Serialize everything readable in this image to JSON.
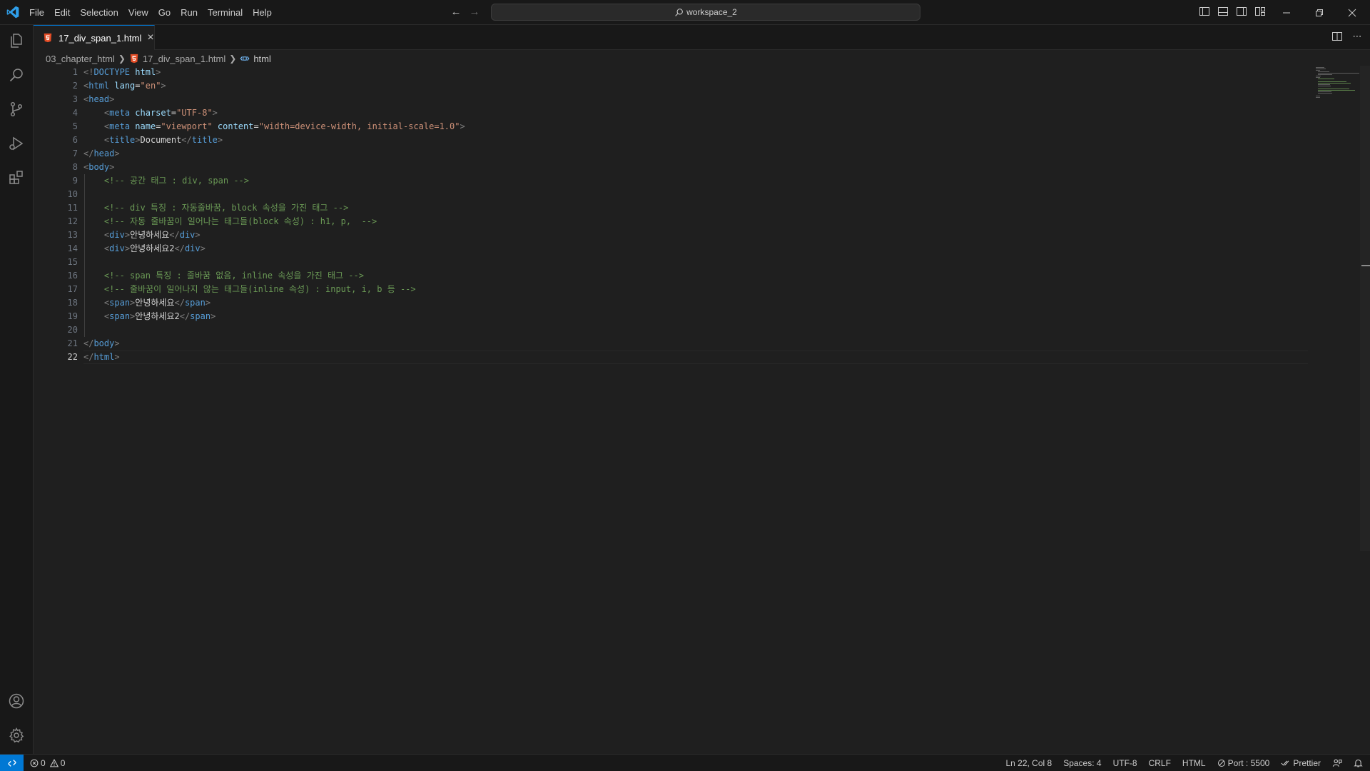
{
  "menu": [
    "File",
    "Edit",
    "Selection",
    "View",
    "Go",
    "Run",
    "Terminal",
    "Help"
  ],
  "command_center": {
    "label": "workspace_2",
    "icon": "search-icon"
  },
  "tab": {
    "label": "17_div_span_1.html",
    "icon": "html5-icon",
    "close": "×"
  },
  "breadcrumb": {
    "folder": "03_chapter_html",
    "file": "17_div_span_1.html",
    "symbol": "html"
  },
  "editor": {
    "active_line": 22,
    "line_numbers": [
      "1",
      "2",
      "3",
      "4",
      "5",
      "6",
      "7",
      "8",
      "9",
      "10",
      "11",
      "12",
      "13",
      "14",
      "15",
      "16",
      "17",
      "18",
      "19",
      "20",
      "21",
      "22"
    ],
    "lines": [
      [
        [
          "pun",
          "<!"
        ],
        [
          "tag",
          "DOCTYPE"
        ],
        [
          "txt",
          " "
        ],
        [
          "attr",
          "html"
        ],
        [
          "pun",
          ">"
        ]
      ],
      [
        [
          "pun",
          "<"
        ],
        [
          "tag",
          "html"
        ],
        [
          "txt",
          " "
        ],
        [
          "attr",
          "lang"
        ],
        [
          "txt",
          "="
        ],
        [
          "str",
          "\"en\""
        ],
        [
          "pun",
          ">"
        ]
      ],
      [
        [
          "pun",
          "<"
        ],
        [
          "tag",
          "head"
        ],
        [
          "pun",
          ">"
        ]
      ],
      [
        [
          "txt",
          "    "
        ],
        [
          "pun",
          "<"
        ],
        [
          "tag",
          "meta"
        ],
        [
          "txt",
          " "
        ],
        [
          "attr",
          "charset"
        ],
        [
          "txt",
          "="
        ],
        [
          "str",
          "\"UTF-8\""
        ],
        [
          "pun",
          ">"
        ]
      ],
      [
        [
          "txt",
          "    "
        ],
        [
          "pun",
          "<"
        ],
        [
          "tag",
          "meta"
        ],
        [
          "txt",
          " "
        ],
        [
          "attr",
          "name"
        ],
        [
          "txt",
          "="
        ],
        [
          "str",
          "\"viewport\""
        ],
        [
          "txt",
          " "
        ],
        [
          "attr",
          "content"
        ],
        [
          "txt",
          "="
        ],
        [
          "str",
          "\"width=device-width, initial-scale=1.0\""
        ],
        [
          "pun",
          ">"
        ]
      ],
      [
        [
          "txt",
          "    "
        ],
        [
          "pun",
          "<"
        ],
        [
          "tag",
          "title"
        ],
        [
          "pun",
          ">"
        ],
        [
          "txt",
          "Document"
        ],
        [
          "pun",
          "</"
        ],
        [
          "tag",
          "title"
        ],
        [
          "pun",
          ">"
        ]
      ],
      [
        [
          "pun",
          "</"
        ],
        [
          "tag",
          "head"
        ],
        [
          "pun",
          ">"
        ]
      ],
      [
        [
          "pun",
          "<"
        ],
        [
          "tag",
          "body"
        ],
        [
          "pun",
          ">"
        ]
      ],
      [
        [
          "txt",
          "    "
        ],
        [
          "com",
          "<!-- 공간 태그 : div, span -->"
        ]
      ],
      [],
      [
        [
          "txt",
          "    "
        ],
        [
          "com",
          "<!-- div 특징 : 자동줄바꿈, block 속성을 가진 태그 -->"
        ]
      ],
      [
        [
          "txt",
          "    "
        ],
        [
          "com",
          "<!-- 자동 줄바꿈이 일어나는 태그들(block 속성) : h1, p,  -->"
        ]
      ],
      [
        [
          "txt",
          "    "
        ],
        [
          "pun",
          "<"
        ],
        [
          "tag",
          "div"
        ],
        [
          "pun",
          ">"
        ],
        [
          "txt",
          "안녕하세요"
        ],
        [
          "pun",
          "</"
        ],
        [
          "tag",
          "div"
        ],
        [
          "pun",
          ">"
        ]
      ],
      [
        [
          "txt",
          "    "
        ],
        [
          "pun",
          "<"
        ],
        [
          "tag",
          "div"
        ],
        [
          "pun",
          ">"
        ],
        [
          "txt",
          "안녕하세요2"
        ],
        [
          "pun",
          "</"
        ],
        [
          "tag",
          "div"
        ],
        [
          "pun",
          ">"
        ]
      ],
      [],
      [
        [
          "txt",
          "    "
        ],
        [
          "com",
          "<!-- span 특징 : 줄바꿈 없음, inline 속성을 가진 태그 -->"
        ]
      ],
      [
        [
          "txt",
          "    "
        ],
        [
          "com",
          "<!-- 줄바꿈이 일어나지 않는 태그들(inline 속성) : input, i, b 등 -->"
        ]
      ],
      [
        [
          "txt",
          "    "
        ],
        [
          "pun",
          "<"
        ],
        [
          "tag",
          "span"
        ],
        [
          "pun",
          ">"
        ],
        [
          "txt",
          "안녕하세요"
        ],
        [
          "pun",
          "</"
        ],
        [
          "tag",
          "span"
        ],
        [
          "pun",
          ">"
        ]
      ],
      [
        [
          "txt",
          "    "
        ],
        [
          "pun",
          "<"
        ],
        [
          "tag",
          "span"
        ],
        [
          "pun",
          ">"
        ],
        [
          "txt",
          "안녕하세요2"
        ],
        [
          "pun",
          "</"
        ],
        [
          "tag",
          "span"
        ],
        [
          "pun",
          ">"
        ]
      ],
      [],
      [
        [
          "pun",
          "</"
        ],
        [
          "tag",
          "body"
        ],
        [
          "pun",
          ">"
        ]
      ],
      [
        [
          "pun",
          "</"
        ],
        [
          "tag",
          "html"
        ],
        [
          "pun",
          ">"
        ]
      ]
    ]
  },
  "status": {
    "errors": "0",
    "warnings": "0",
    "position": "Ln 22, Col 8",
    "spaces": "Spaces: 4",
    "encoding": "UTF-8",
    "eol": "CRLF",
    "language": "HTML",
    "port": "Port : 5500",
    "prettier": "Prettier"
  },
  "colors": {
    "accent": "#0078d4",
    "background": "#1f1f1f",
    "chrome": "#181818"
  }
}
